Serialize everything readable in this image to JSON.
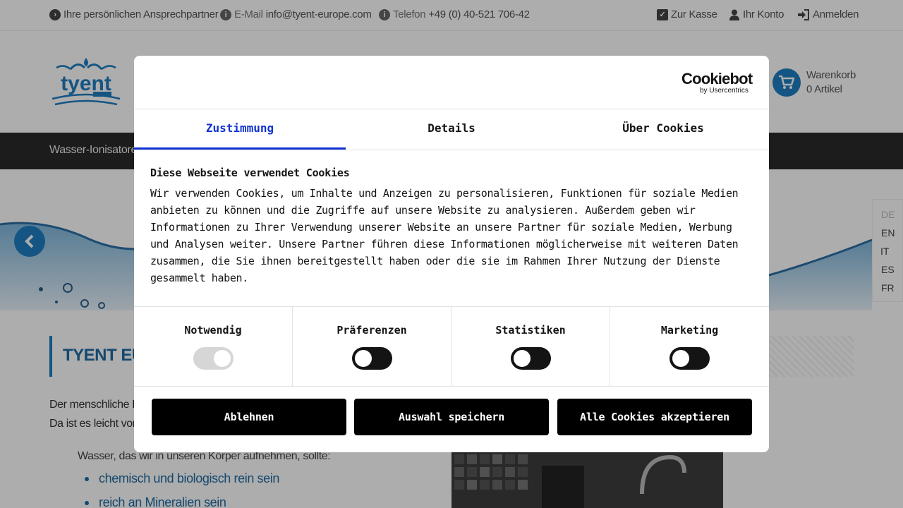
{
  "topbar": {
    "contact_person": "Ihre persönlichen Ansprechpartner",
    "email_label": "E-Mail",
    "email_value": "info@tyent-europe.com",
    "phone_label": "Telefon",
    "phone_value": "+49 (0) 40-521 706-42",
    "checkout": "Zur Kasse",
    "account": "Ihr Konto",
    "login": "Anmelden"
  },
  "header": {
    "cart_title": "Warenkorb",
    "cart_count": "0 Artikel"
  },
  "nav": {
    "first_item": "Wasser-Ionisatoren"
  },
  "languages": [
    "DE",
    "EN",
    "IT",
    "ES",
    "FR"
  ],
  "content": {
    "heading": "TYENT EUR",
    "para_line1": "Der menschliche K",
    "para_line2": "Da ist es leicht vors",
    "sub": "Wasser, das wir in unseren Körper aufnehmen, sollte:",
    "bullet1": "chemisch und biologisch rein sein",
    "bullet2": "reich an Mineralien sein"
  },
  "cookie_dialog": {
    "brand_name": "Cookiebot",
    "brand_sub": "by Usercentrics",
    "tabs": [
      "Zustimmung",
      "Details",
      "Über Cookies"
    ],
    "title": "Diese Webseite verwendet Cookies",
    "text": "Wir verwenden Cookies, um Inhalte und Anzeigen zu personalisieren, Funktionen für soziale Medien anbieten zu können und die Zugriffe auf unsere Website zu analysieren. Außerdem geben wir Informationen zu Ihrer Verwendung unserer Website an unsere Partner für soziale Medien, Werbung und Analysen weiter. Unsere Partner führen diese Informationen möglicherweise mit weiteren Daten zusammen, die Sie ihnen bereitgestellt haben oder die sie im Rahmen Ihrer Nutzung der Dienste gesammelt haben.",
    "categories": [
      {
        "label": "Notwendig",
        "checked": true,
        "disabled": true
      },
      {
        "label": "Präferenzen",
        "checked": false,
        "disabled": false
      },
      {
        "label": "Statistiken",
        "checked": false,
        "disabled": false
      },
      {
        "label": "Marketing",
        "checked": false,
        "disabled": false
      }
    ],
    "btn_decline": "Ablehnen",
    "btn_save": "Auswahl speichern",
    "btn_accept": "Alle Cookies akzeptieren"
  },
  "colors": {
    "accent": "#1e7ec2",
    "tab_active": "#1032cf",
    "nav_bg": "#2a2a2a",
    "button_bg": "#000000"
  }
}
